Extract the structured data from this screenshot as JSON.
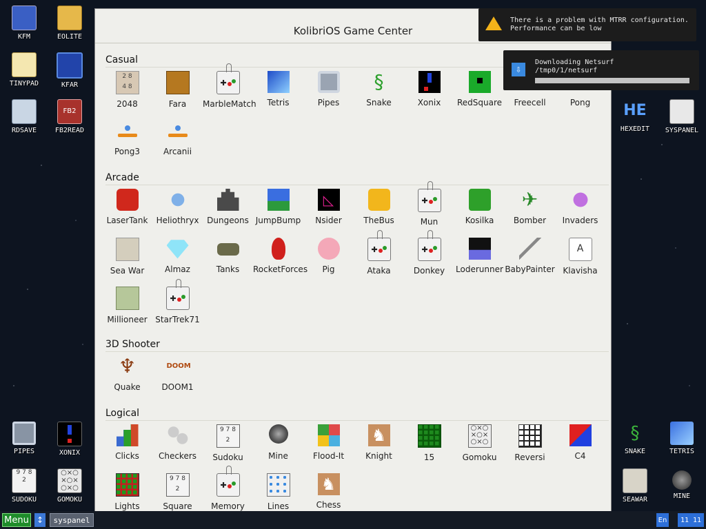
{
  "window": {
    "title": "KolibriOS Game Center"
  },
  "desktop_left": [
    {
      "label": "KFM",
      "icon": "floppy-disk-icon"
    },
    {
      "label": "EOLITE",
      "icon": "folder-icon"
    },
    {
      "label": "TINYPAD",
      "icon": "notepad-icon"
    },
    {
      "label": "KFAR",
      "icon": "file-manager-icon"
    },
    {
      "label": "RDSAVE",
      "icon": "ramdisk-save-icon"
    },
    {
      "label": "FB2READ",
      "icon": "book-reader-icon"
    },
    {
      "label": "PIPES",
      "icon": "pipes-icon"
    },
    {
      "label": "XONIX",
      "icon": "xonix-icon"
    },
    {
      "label": "SUDOKU",
      "icon": "sudoku-icon"
    },
    {
      "label": "GOMOKU",
      "icon": "gomoku-icon"
    }
  ],
  "desktop_right": [
    {
      "label": "HEXEDIT",
      "icon": "hex-editor-icon"
    },
    {
      "label": "SYSPANEL",
      "icon": "sliders-icon"
    },
    {
      "label": "SNAKE",
      "icon": "snake-icon"
    },
    {
      "label": "TETRIS",
      "icon": "tetris-icon"
    },
    {
      "label": "SEAWAR",
      "icon": "ship-icon"
    },
    {
      "label": "MINE",
      "icon": "mine-icon"
    }
  ],
  "sections": [
    {
      "title": "Casual",
      "apps": [
        "2048",
        "Fara",
        "MarbleMatch",
        "Tetris",
        "Pipes",
        "Snake",
        "Xonix",
        "RedSquare",
        "Freecell",
        "Pong",
        "Pong3",
        "Arcanii"
      ]
    },
    {
      "title": "Arcade",
      "apps": [
        "LaserTank",
        "Heliothryx",
        "Dungeons",
        "JumpBump",
        "Nsider",
        "TheBus",
        "Mun",
        "Kosilka",
        "Bomber",
        "Invaders",
        "Sea War",
        "Almaz",
        "Tanks",
        "RocketForces",
        "Pig",
        "Ataka",
        "Donkey",
        "Loderunner",
        "BabyPainter",
        "Klavisha",
        "Millioneer",
        "StarTrek71"
      ]
    },
    {
      "title": "3D Shooter",
      "apps": [
        "Quake",
        "DOOM1"
      ]
    },
    {
      "title": "Logical",
      "apps": [
        "Clicks",
        "Checkers",
        "Sudoku",
        "Mine",
        "Flood-It",
        "Knight",
        "15",
        "Gomoku",
        "Reversi",
        "C4",
        "Lights",
        "Square",
        "Memory",
        "Lines",
        "Chess"
      ]
    }
  ],
  "notifications": {
    "mtrr": {
      "line1": "There is a problem with MTRR configuration.",
      "line2": "Performance can be low",
      "icon": "warning-icon"
    },
    "download": {
      "title": "Downloading Netsurf",
      "path": "/tmp0/1/netsurf",
      "icon": "download-icon",
      "progress": 0
    }
  },
  "taskbar": {
    "menu": "Menu",
    "switch": "↕",
    "task": "syspanel",
    "lang": "En",
    "clock": "11 11"
  }
}
